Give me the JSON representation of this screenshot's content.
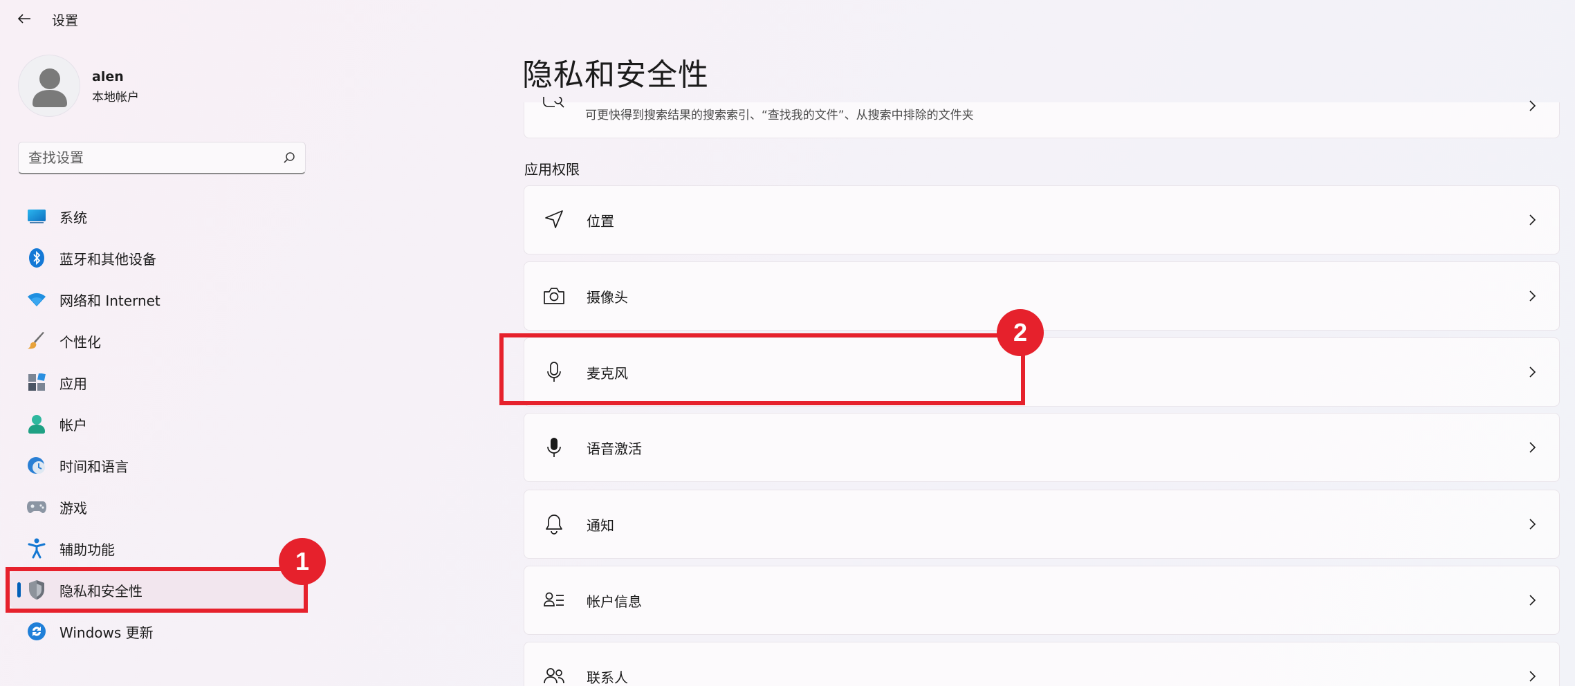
{
  "titlebar": {
    "title": "设置"
  },
  "profile": {
    "name": "alen",
    "account_type": "本地帐户"
  },
  "search": {
    "placeholder": "查找设置"
  },
  "sidebar": {
    "items": [
      {
        "label": "系统",
        "icon": "system-icon"
      },
      {
        "label": "蓝牙和其他设备",
        "icon": "bluetooth-icon"
      },
      {
        "label": "网络和 Internet",
        "icon": "wifi-icon"
      },
      {
        "label": "个性化",
        "icon": "brush-icon"
      },
      {
        "label": "应用",
        "icon": "apps-icon"
      },
      {
        "label": "帐户",
        "icon": "account-icon"
      },
      {
        "label": "时间和语言",
        "icon": "time-language-icon"
      },
      {
        "label": "游戏",
        "icon": "gamepad-icon"
      },
      {
        "label": "辅助功能",
        "icon": "accessibility-icon"
      },
      {
        "label": "隐私和安全性",
        "icon": "shield-icon",
        "selected": true
      },
      {
        "label": "Windows 更新",
        "icon": "update-icon"
      }
    ]
  },
  "main": {
    "title": "隐私和安全性",
    "partial_card": {
      "description": "可更快得到搜索结果的搜索索引、“查找我的文件”、从搜索中排除的文件夹"
    },
    "section": "应用权限",
    "cards": [
      {
        "label": "位置",
        "icon": "location-icon"
      },
      {
        "label": "摄像头",
        "icon": "camera-icon"
      },
      {
        "label": "麦克风",
        "icon": "microphone-icon"
      },
      {
        "label": "语音激活",
        "icon": "voice-activation-icon"
      },
      {
        "label": "通知",
        "icon": "bell-icon"
      },
      {
        "label": "帐户信息",
        "icon": "account-info-icon"
      },
      {
        "label": "联系人",
        "icon": "contacts-icon"
      }
    ]
  },
  "annotations": {
    "badge1": "1",
    "badge2": "2"
  },
  "colors": {
    "accent": "#005fb8",
    "annotation": "#e6212c"
  }
}
